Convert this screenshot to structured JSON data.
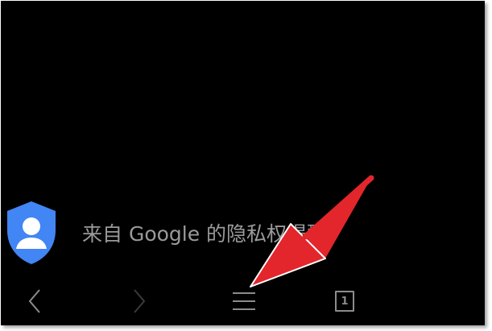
{
  "notice": {
    "text": "来自 Google 的隐私权提醒",
    "icon": "account-shield-icon",
    "icon_colors": {
      "shield": "#4285f4",
      "figure": "#ffffff"
    }
  },
  "nav_bar": {
    "items": [
      {
        "name": "back",
        "icon": "chevron-left-icon"
      },
      {
        "name": "forward",
        "icon": "chevron-right-icon"
      },
      {
        "name": "menu",
        "icon": "hamburger-menu-icon"
      },
      {
        "name": "tabs",
        "icon": "tab-count-icon",
        "count": "1"
      }
    ]
  },
  "annotation": {
    "type": "red-arrow",
    "color": "#e3262b",
    "points_to": "menu"
  },
  "colors": {
    "background": "#000000",
    "text": "#9a9a9a",
    "nav_icon": "#8c8c8c",
    "nav_icon_disabled": "#3a3a3a"
  }
}
